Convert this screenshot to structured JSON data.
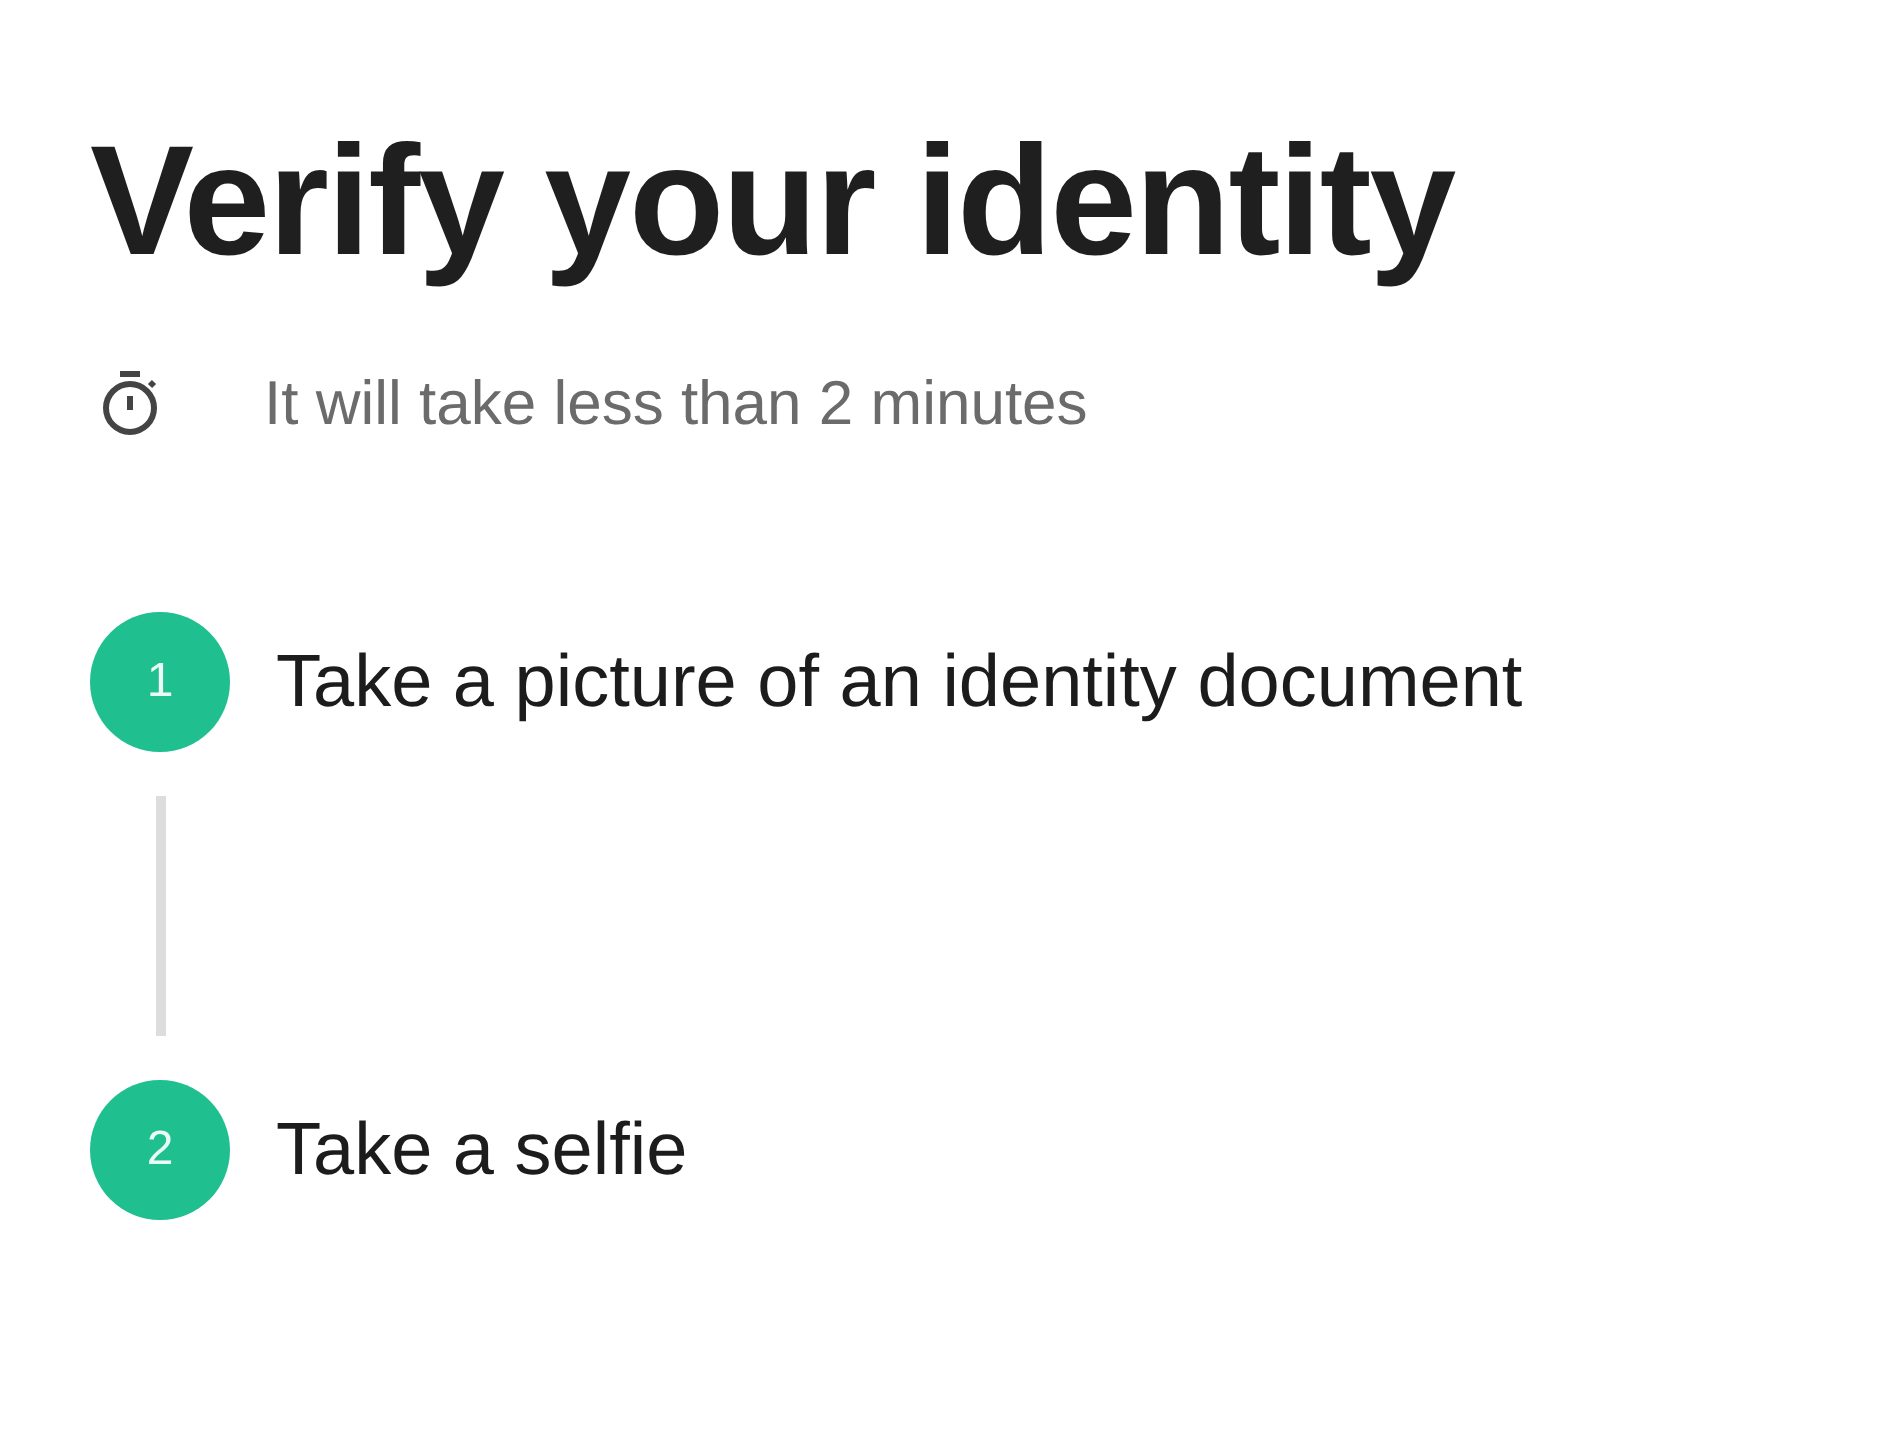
{
  "title": "Verify your identity",
  "duration": {
    "text": "It will take less than 2 minutes"
  },
  "steps": [
    {
      "number": "1",
      "label": "Take a picture of an identity document"
    },
    {
      "number": "2",
      "label": "Take a selfie"
    }
  ]
}
